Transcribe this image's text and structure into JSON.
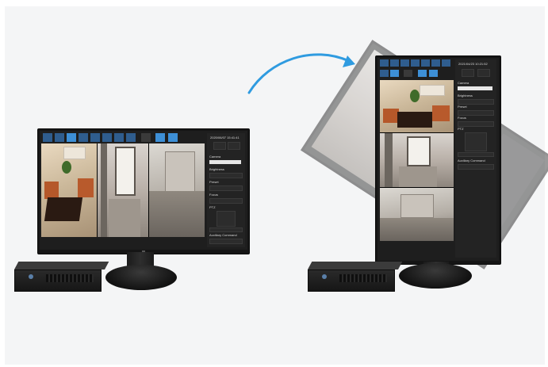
{
  "landscape_monitor": {
    "clock": "2020/06/07 15:41:41",
    "labels": [
      "Camera",
      "Brightness",
      "Preset",
      "Focus",
      "PTZ",
      "Auxiliary Command"
    ]
  },
  "portrait_monitor": {
    "clock": "2021/04/23 10:21:52",
    "labels": [
      "Camera",
      "Brightness",
      "Preset",
      "Focus",
      "PTZ",
      "Auxiliary Command"
    ]
  },
  "colors": {
    "background": "#f4f5f6",
    "arrow": "#2f9be0",
    "toolbar_blue": "#2f5d8e",
    "monitor_body": "#1a1a1a"
  }
}
